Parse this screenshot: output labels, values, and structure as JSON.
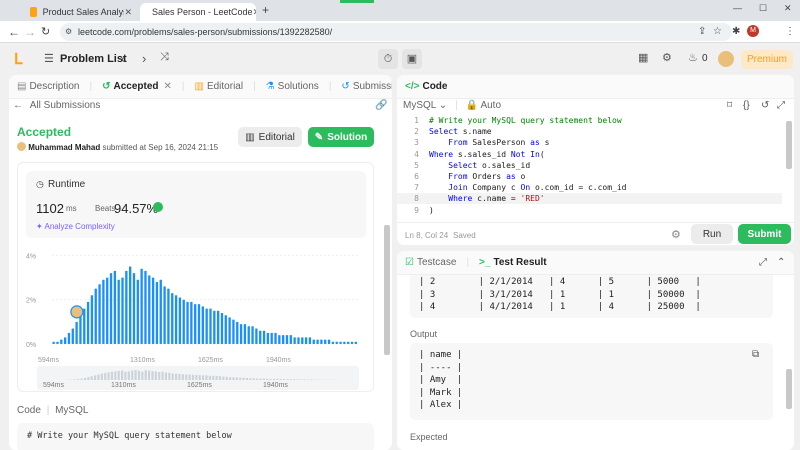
{
  "browser": {
    "tabs": [
      {
        "title": "Product Sales Analysis III - Lee"
      },
      {
        "title": "Sales Person - LeetCode"
      }
    ],
    "url": "leetcode.com/problems/sales-person/submissions/1392282580/",
    "profile_initial": "M"
  },
  "header": {
    "problem_list": "Problem List",
    "fire_count": "0",
    "premium": "Premium"
  },
  "left": {
    "tabs": {
      "description": "Description",
      "accepted": "Accepted",
      "editorial": "Editorial",
      "solutions": "Solutions",
      "submissions": "Submissions"
    },
    "all_submissions": "All Submissions",
    "status": "Accepted",
    "user": "Muhammad Mahad",
    "submitted_at": "submitted at Sep 16, 2024 21:15",
    "editorial_btn": "Editorial",
    "solution_btn": "Solution",
    "runtime_label": "Runtime",
    "runtime_value": "1102",
    "runtime_unit": "ms",
    "beats_label": "Beats",
    "beats_value": "94.57%",
    "analyze": "Analyze Complexity",
    "code_label": "Code",
    "lang_label": "MySQL",
    "code_preview": "# Write your MySQL query statement below"
  },
  "chart_data": {
    "type": "bar",
    "ytick_labels": [
      "4%",
      "2%",
      "0%"
    ],
    "ylim": [
      0,
      4.2
    ],
    "xtick_labels": [
      "594ms",
      "1310ms",
      "1625ms",
      "1940ms"
    ],
    "mini_xtick_labels": [
      "594ms",
      "1310ms",
      "1625ms",
      "1940ms"
    ],
    "values": [
      0.1,
      0.1,
      0.2,
      0.3,
      0.5,
      0.7,
      1.0,
      1.3,
      1.6,
      1.9,
      2.2,
      2.5,
      2.7,
      2.9,
      3.0,
      3.2,
      3.3,
      2.9,
      3.0,
      3.3,
      3.5,
      3.2,
      2.9,
      3.4,
      3.3,
      3.1,
      3.0,
      2.8,
      2.9,
      2.6,
      2.5,
      2.3,
      2.2,
      2.1,
      2.0,
      1.9,
      1.9,
      1.8,
      1.8,
      1.7,
      1.6,
      1.6,
      1.5,
      1.5,
      1.4,
      1.3,
      1.2,
      1.1,
      1.0,
      0.9,
      0.9,
      0.8,
      0.8,
      0.7,
      0.6,
      0.6,
      0.5,
      0.5,
      0.5,
      0.4,
      0.4,
      0.4,
      0.4,
      0.3,
      0.3,
      0.3,
      0.3,
      0.3,
      0.2,
      0.2,
      0.2,
      0.2,
      0.2,
      0.1,
      0.1,
      0.1,
      0.1,
      0.1,
      0.1,
      0.1
    ],
    "colors": {
      "bar": "#1a90ff",
      "bar_light": "#cdd3da",
      "highlight": "#1a90ff"
    }
  },
  "editor": {
    "title": "Code",
    "language": "MySQL",
    "auto": "Auto",
    "lines": [
      {
        "n": "1",
        "text": "# Write your MySQL query statement below"
      },
      {
        "n": "2",
        "text": "Select s.name"
      },
      {
        "n": "3",
        "text": "    From SalesPerson as s"
      },
      {
        "n": "4",
        "text": "Where s.sales_id Not In("
      },
      {
        "n": "5",
        "text": "    Select o.sales_id"
      },
      {
        "n": "6",
        "text": "    From Orders as o"
      },
      {
        "n": "7",
        "text": "    Join Company c On o.com_id = c.com_id"
      },
      {
        "n": "8",
        "text": "    Where c.name = 'RED'"
      },
      {
        "n": "9",
        "text": ")"
      }
    ],
    "cursor": "Ln 8, Col 24",
    "saved": "Saved",
    "run": "Run",
    "submit": "Submit"
  },
  "result": {
    "testcase_tab": "Testcase",
    "result_tab": "Test Result",
    "rows": [
      "| 2        | 2/1/2014   | 4      | 5      | 5000   |",
      "| 3        | 3/1/2014   | 1      | 1      | 50000  |",
      "| 4        | 4/1/2014   | 1      | 4      | 25000  |"
    ],
    "output_label": "Output",
    "output_lines": [
      "| name |",
      "| ---- |",
      "| Amy  |",
      "| Mark |",
      "| Alex |"
    ],
    "expected_label": "Expected"
  }
}
